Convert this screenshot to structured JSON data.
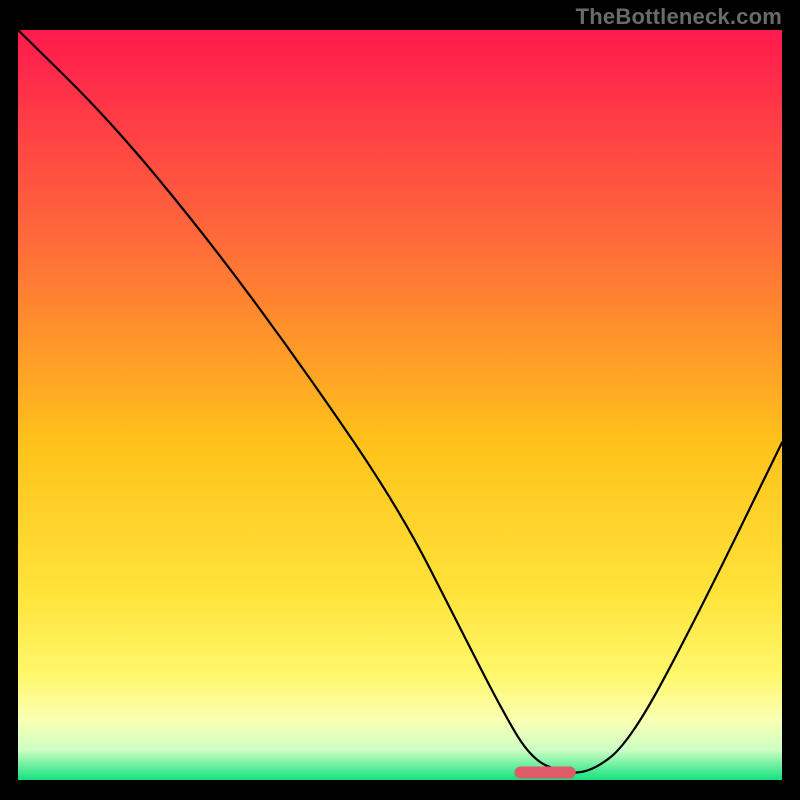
{
  "watermark": "TheBottleneck.com",
  "colors": {
    "gradient_top": "#ff1a4e",
    "gradient_mid_upper": "#ff6a3a",
    "gradient_mid": "#ffc21a",
    "gradient_mid_lower": "#ffe33a",
    "gradient_low1": "#fff86b",
    "gradient_low2": "#faffb3",
    "gradient_low3": "#ccffc3",
    "gradient_bottom": "#14e07e",
    "curve": "#000000",
    "marker": "#e05a6a",
    "frame": "#000000"
  },
  "chart_data": {
    "type": "line",
    "title": "",
    "xlabel": "",
    "ylabel": "",
    "xlim": [
      0,
      100
    ],
    "ylim": [
      0,
      100
    ],
    "series": [
      {
        "name": "bottleneck-curve",
        "x": [
          0,
          12,
          25,
          38,
          50,
          58,
          63,
          67,
          71,
          75,
          80,
          88,
          100
        ],
        "values": [
          100,
          88,
          72,
          54,
          36,
          20,
          10,
          3,
          1,
          1,
          5,
          20,
          45
        ]
      }
    ],
    "marker": {
      "x_start": 65,
      "x_end": 73,
      "y": 1
    },
    "grid": false,
    "legend": false
  }
}
